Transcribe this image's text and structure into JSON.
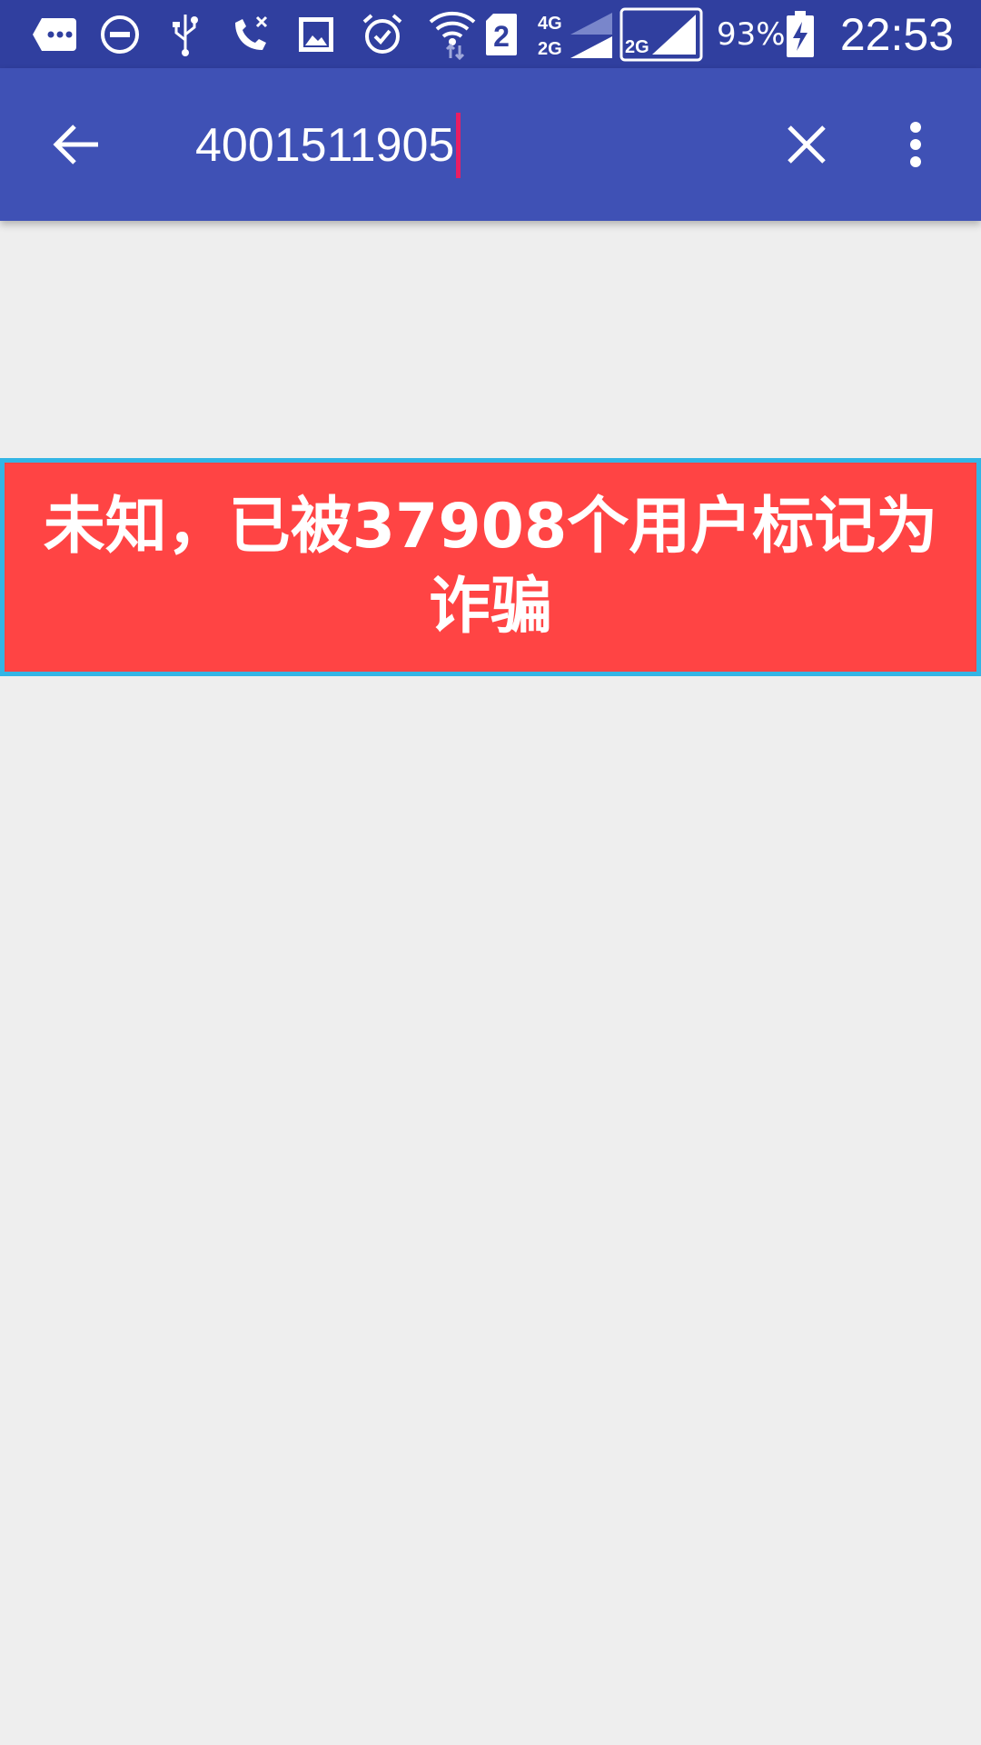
{
  "status_bar": {
    "battery_percent": "93%",
    "time": "22:53",
    "sim_slot": "2",
    "network_labels": [
      "4G",
      "2G",
      "2G"
    ],
    "icons": [
      "message-icon",
      "do-not-disturb-icon",
      "usb-icon",
      "missed-call-icon",
      "image-icon",
      "alarm-icon",
      "wifi-icon",
      "sim2-icon",
      "signal-icon",
      "signal-icon",
      "battery-charging-icon"
    ]
  },
  "app_bar": {
    "search_value": "4001511905",
    "icons": [
      "back-arrow-icon",
      "close-icon",
      "more-vert-icon"
    ]
  },
  "result": {
    "message": "未知，已被37908个用户标记为诈骗"
  },
  "colors": {
    "status_bar": "#303F9F",
    "app_bar": "#3F51B5",
    "caret": "#E91E63",
    "banner_bg": "#FF4444",
    "banner_border": "#33B5E5",
    "background": "#EEEEEE"
  }
}
